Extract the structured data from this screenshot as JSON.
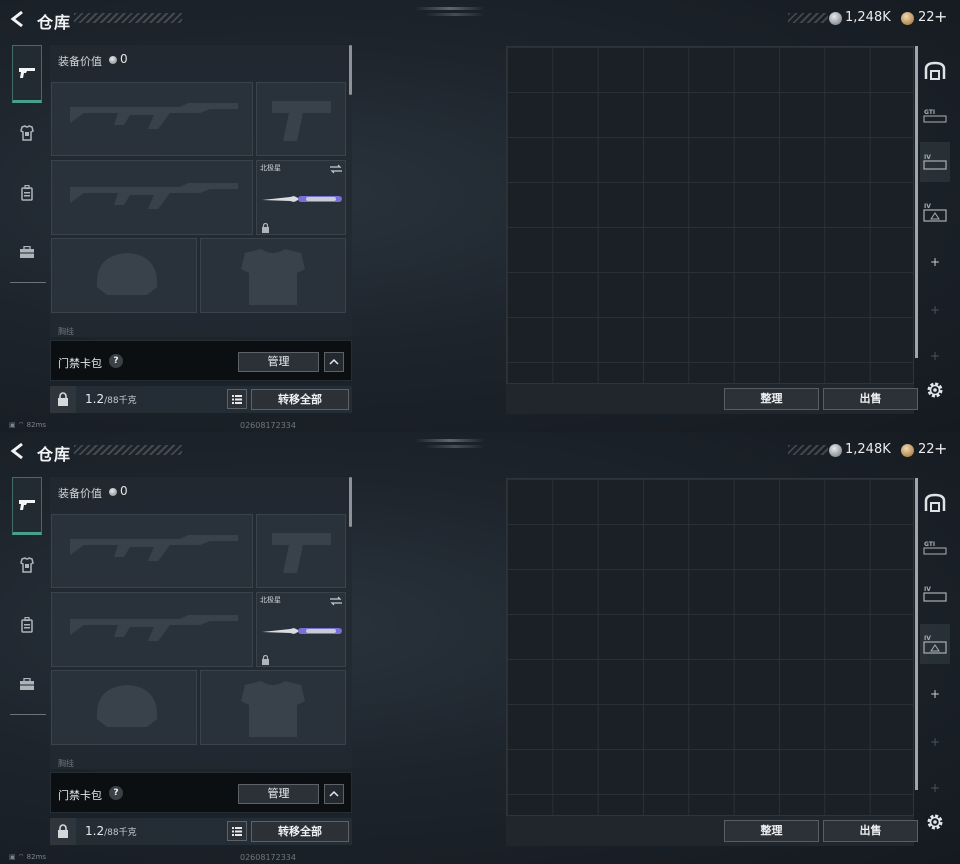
{
  "frames": [
    {
      "header": {
        "title": "仓库"
      },
      "currency": {
        "silver": "1,248K",
        "bronze": "22",
        "plus": "+"
      },
      "equipment": {
        "label": "装备价值",
        "value": "0",
        "knife_name": "北极星",
        "cut_label": "胸挂"
      },
      "card_bag": {
        "label": "门禁卡包",
        "help": "?",
        "manage": "管理"
      },
      "weight": {
        "value": "1.2",
        "unit": "/88千克"
      },
      "transfer_all": "转移全部",
      "storage": {
        "sort": "整理",
        "sell": "出售",
        "active_tab": "IV-1"
      },
      "status": {
        "ping": "82ms",
        "code": "02608172334"
      }
    },
    {
      "header": {
        "title": "仓库"
      },
      "currency": {
        "silver": "1,248K",
        "bronze": "22",
        "plus": "+"
      },
      "equipment": {
        "label": "装备价值",
        "value": "0",
        "knife_name": "北极星",
        "cut_label": "胸挂"
      },
      "card_bag": {
        "label": "门禁卡包",
        "help": "?",
        "manage": "管理"
      },
      "weight": {
        "value": "1.2",
        "unit": "/88千克"
      },
      "transfer_all": "转移全部",
      "storage": {
        "sort": "整理",
        "sell": "出售",
        "active_tab": "IV-3"
      },
      "status": {
        "ping": "82ms",
        "code": "02608172334"
      }
    }
  ],
  "icons": {
    "back": "chevron-left-icon",
    "rail": [
      "pistol-icon",
      "armor-icon",
      "backpack-icon",
      "toolbox-icon"
    ],
    "right_rail": [
      "safe-box-icon",
      "gti-case-icon",
      "iv-case-icon",
      "iv-case-icon",
      "plus-icon",
      "plus-icon",
      "plus-icon",
      "gear-icon"
    ]
  },
  "colors": {
    "accent": "#46a08c",
    "background": "#1b2128",
    "panel": "#222931"
  }
}
